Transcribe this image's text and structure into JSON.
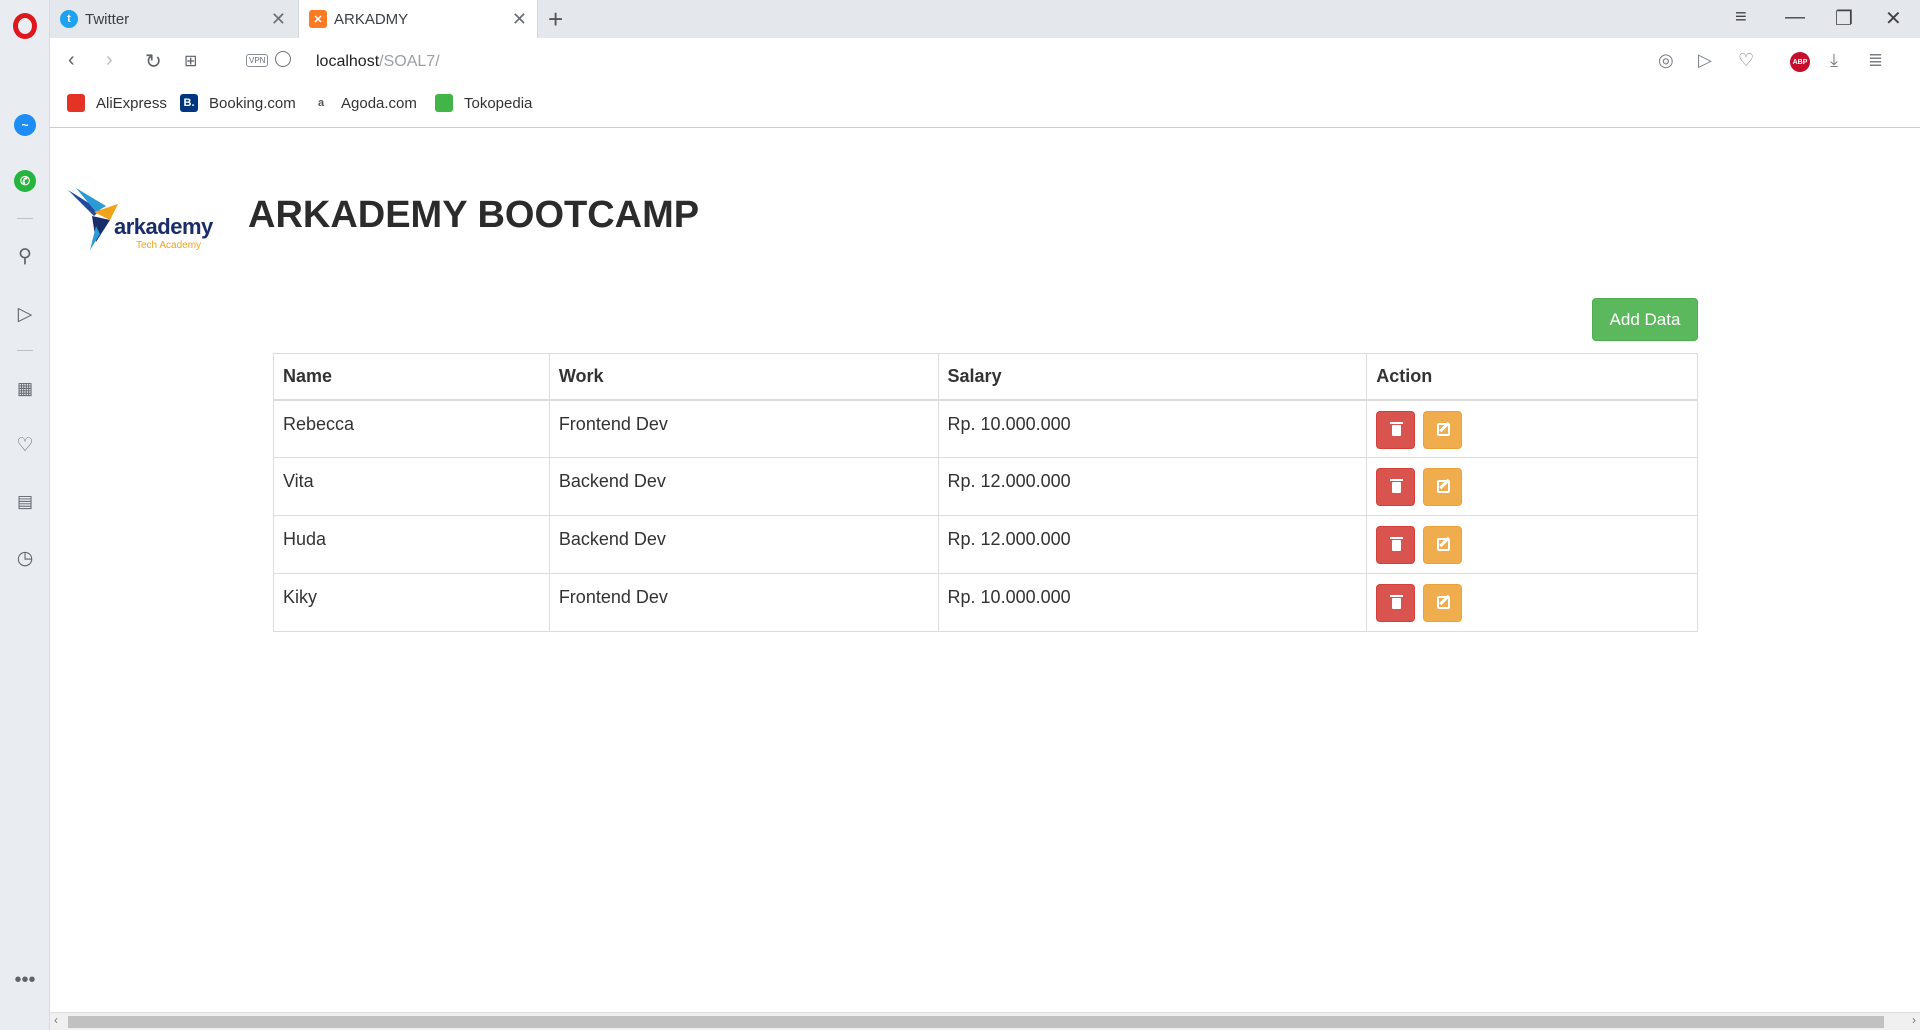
{
  "browser": {
    "tabs": [
      {
        "title": "Twitter",
        "icon": "twitter-icon",
        "active": false
      },
      {
        "title": "ARKADMY",
        "icon": "xampp-icon",
        "active": true
      }
    ],
    "address": {
      "host": "localhost",
      "path": "/SOAL7/"
    },
    "vpn_label": "VPN",
    "abp_label": "ABP",
    "bookmarks": [
      {
        "label": "AliExpress",
        "icon": "aliexpress-icon"
      },
      {
        "label": "Booking.com",
        "icon": "booking-icon",
        "icon_text": "B."
      },
      {
        "label": "Agoda.com",
        "icon": "agoda-icon",
        "icon_text": "a"
      },
      {
        "label": "Tokopedia",
        "icon": "tokopedia-icon"
      }
    ]
  },
  "page": {
    "logo": {
      "name": "arkademy",
      "tagline": "Tech Academy"
    },
    "title_regular": "ARKADEMY",
    "title_bold": "BOOTCAMP",
    "add_button": "Add Data",
    "table": {
      "headers": [
        "Name",
        "Work",
        "Salary",
        "Action"
      ],
      "rows": [
        {
          "name": "Rebecca",
          "work": "Frontend Dev",
          "salary": "Rp. 10.000.000"
        },
        {
          "name": "Vita",
          "work": "Backend Dev",
          "salary": "Rp. 12.000.000"
        },
        {
          "name": "Huda",
          "work": "Backend Dev",
          "salary": "Rp. 12.000.000"
        },
        {
          "name": "Kiky",
          "work": "Frontend Dev",
          "salary": "Rp. 10.000.000"
        }
      ]
    }
  },
  "colors": {
    "add_button": "#5cb85c",
    "delete_button": "#d9534f",
    "edit_button": "#f0ad4e",
    "opera_red": "#e0161d"
  }
}
